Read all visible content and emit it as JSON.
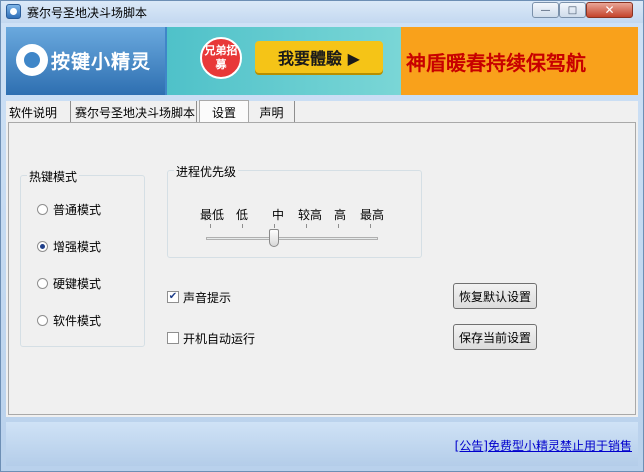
{
  "window": {
    "title": "赛尔号圣地决斗场脚本",
    "controls": {
      "minimize": "—",
      "maximize": "□",
      "close": "✕"
    }
  },
  "banner": {
    "logo_text": "按键小精灵",
    "badge_text": "兄弟招募",
    "cta_text": "我要體驗 ▶",
    "ad_text": "神盾暖春持续保驾航"
  },
  "tabs": [
    {
      "label": "软件说明",
      "active": false
    },
    {
      "label": "赛尔号圣地决斗场脚本",
      "active": false
    },
    {
      "label": "设置",
      "active": true
    },
    {
      "label": "声明",
      "active": false
    }
  ],
  "hotkey_group": {
    "title": "热键模式",
    "options": [
      {
        "label": "普通模式",
        "selected": false
      },
      {
        "label": "增强模式",
        "selected": true
      },
      {
        "label": "硬键模式",
        "selected": false
      },
      {
        "label": "软件模式",
        "selected": false
      }
    ]
  },
  "priority_group": {
    "title": "进程优先级",
    "levels": [
      "最低",
      "低",
      "中",
      "较高",
      "高",
      "最高"
    ],
    "selected_index": 2
  },
  "options": {
    "sound_prompt": {
      "label": "声音提示",
      "checked": true
    },
    "autostart": {
      "label": "开机自动运行",
      "checked": false
    }
  },
  "buttons": {
    "restore_defaults": "恢复默认设置",
    "save_current": "保存当前设置"
  },
  "footer": {
    "notice_link": "[公告]免费型小精灵禁止用于销售"
  }
}
